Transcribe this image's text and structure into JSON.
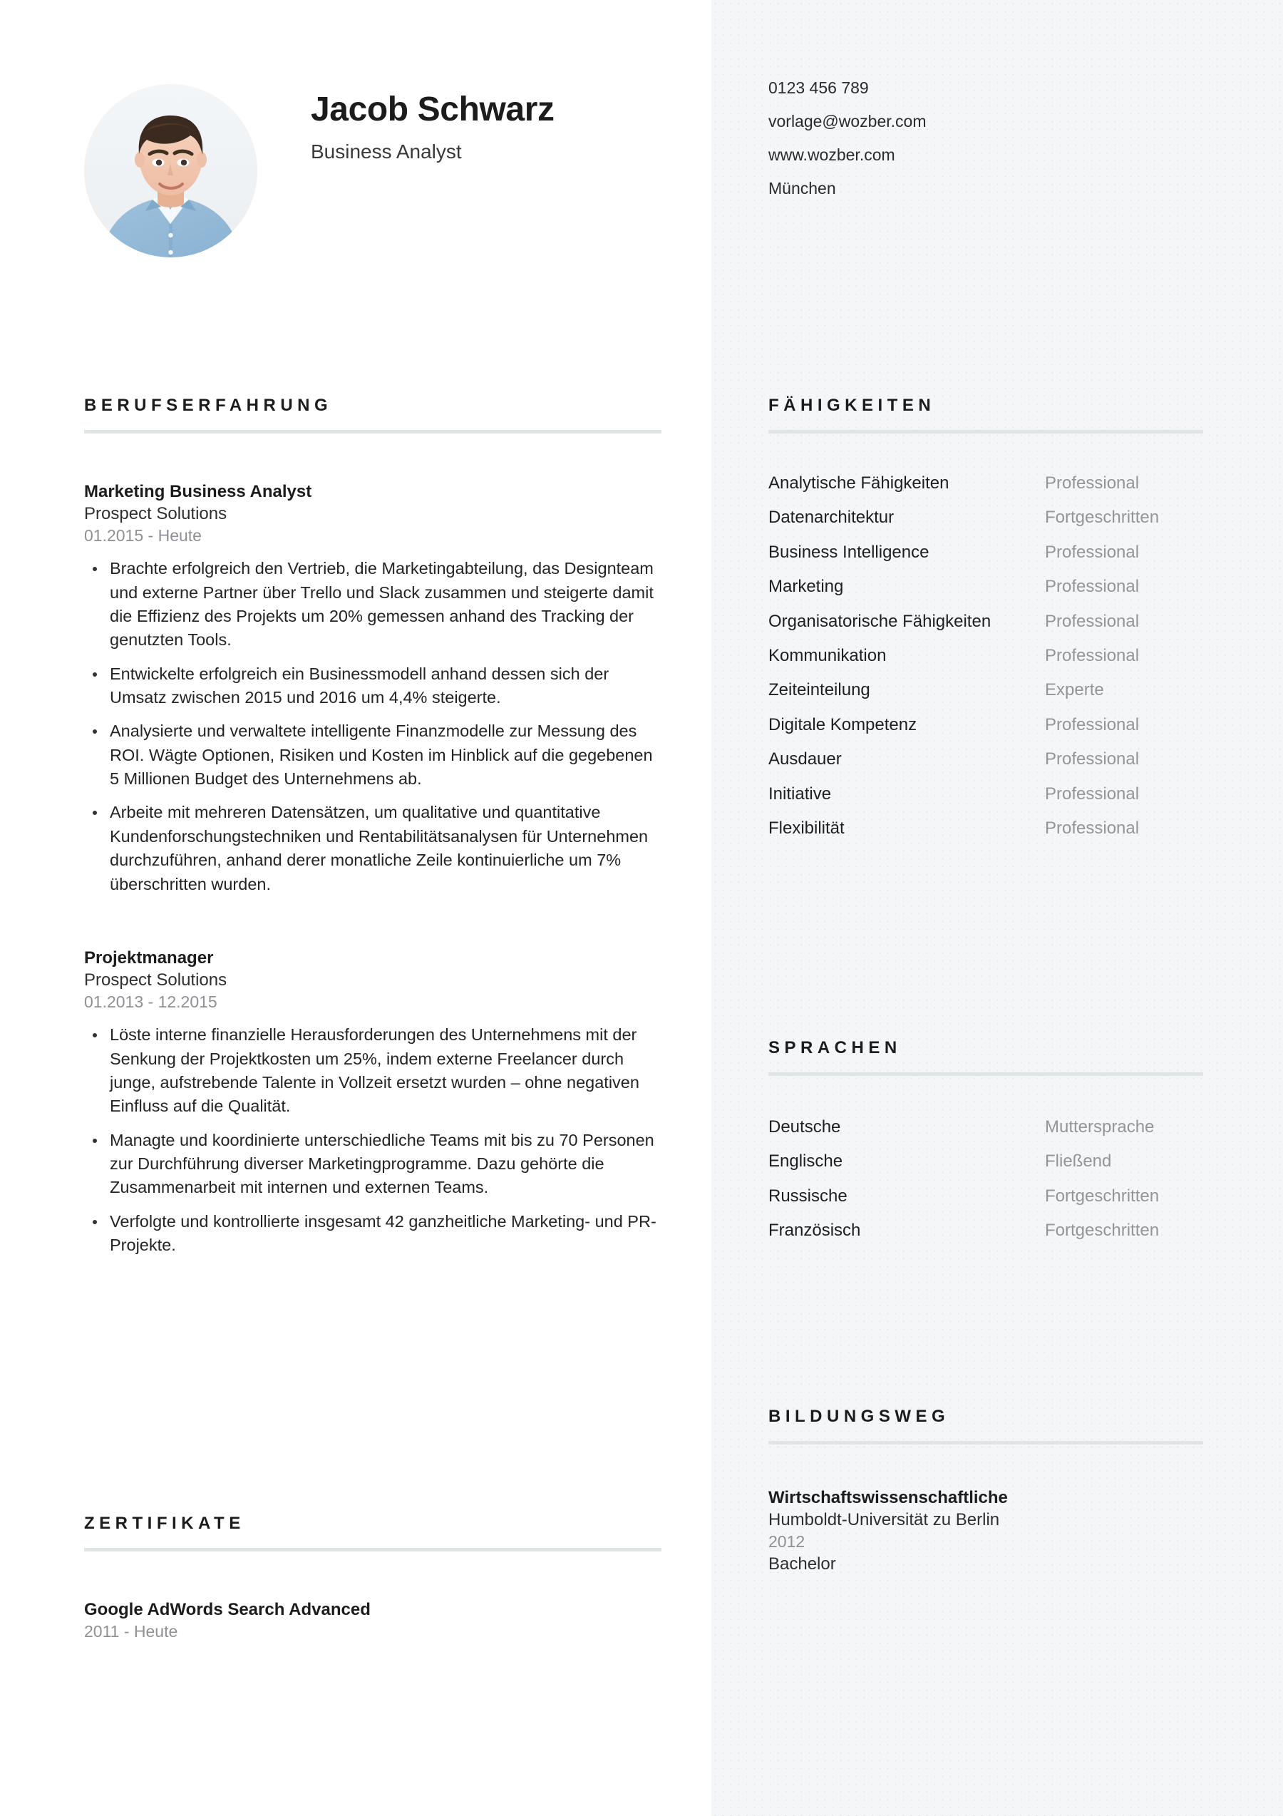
{
  "profile": {
    "name": "Jacob Schwarz",
    "job_title": "Business Analyst",
    "photo_alt": "portrait-photo"
  },
  "contact": {
    "phone": "0123 456 789",
    "email": "vorlage@wozber.com",
    "website": "www.wozber.com",
    "city": "München"
  },
  "sections": {
    "experience_title": "BERUFSERFAHRUNG",
    "certificates_title": "ZERTIFIKATE",
    "skills_title": "FÄHIGKEITEN",
    "languages_title": "SPRACHEN",
    "education_title": "BILDUNGSWEG"
  },
  "experience": [
    {
      "title": "Marketing Business Analyst",
      "company": "Prospect Solutions",
      "date": "01.2015 - Heute",
      "bullets": [
        "Brachte erfolgreich den Vertrieb, die Marketingabteilung, das Designteam und externe Partner über Trello und Slack zusammen und steigerte damit die Effizienz des Projekts um 20% gemessen anhand des Tracking der genutzten Tools.",
        "Entwickelte erfolgreich ein Businessmodell anhand dessen sich der Umsatz zwischen 2015 und 2016 um 4,4% steigerte.",
        "Analysierte und verwaltete intelligente Finanzmodelle zur Messung des ROI. Wägte Optionen, Risiken und Kosten im Hinblick auf die gegebenen 5 Millionen Budget des Unternehmens ab.",
        "Arbeite mit mehreren Datensätzen, um qualitative und quantitative Kundenforschungstechniken und Rentabilitätsanalysen für Unternehmen durchzuführen, anhand derer monatliche Zeile kontinuierliche um 7% überschritten wurden."
      ]
    },
    {
      "title": "Projektmanager",
      "company": "Prospect Solutions",
      "date": "01.2013 - 12.2015",
      "bullets": [
        "Löste interne finanzielle Herausforderungen des Unternehmens mit der Senkung der Projektkosten um 25%, indem externe Freelancer durch junge, aufstrebende Talente in Vollzeit ersetzt wurden – ohne negativen Einfluss auf die Qualität.",
        "Managte und koordinierte unterschiedliche Teams mit bis zu 70 Personen zur Durchführung diverser Marketingprogramme. Dazu gehörte die Zusammenarbeit mit internen und externen Teams.",
        "Verfolgte und kontrollierte insgesamt 42 ganzheitliche Marketing- und PR-Projekte."
      ]
    }
  ],
  "certificates": [
    {
      "title": "Google AdWords Search Advanced",
      "date": "2011 - Heute"
    }
  ],
  "skills": [
    {
      "name": "Analytische Fähigkeiten",
      "level": "Professional"
    },
    {
      "name": "Datenarchitektur",
      "level": "Fortgeschritten"
    },
    {
      "name": "Business Intelligence",
      "level": "Professional"
    },
    {
      "name": "Marketing",
      "level": "Professional"
    },
    {
      "name": "Organisatorische Fähigkeiten",
      "level": "Professional"
    },
    {
      "name": "Kommunikation",
      "level": "Professional"
    },
    {
      "name": "Zeiteinteilung",
      "level": "Experte"
    },
    {
      "name": "Digitale Kompetenz",
      "level": "Professional"
    },
    {
      "name": "Ausdauer",
      "level": "Professional"
    },
    {
      "name": "Initiative",
      "level": "Professional"
    },
    {
      "name": "Flexibilität",
      "level": "Professional"
    }
  ],
  "languages": [
    {
      "name": "Deutsche",
      "level": "Muttersprache"
    },
    {
      "name": "Englische",
      "level": "Fließend"
    },
    {
      "name": "Russische",
      "level": "Fortgeschritten"
    },
    {
      "name": "Französisch",
      "level": "Fortgeschritten"
    }
  ],
  "education": [
    {
      "degree": "Wirtschaftswissenschaftliche",
      "school": "Humboldt-Universität zu Berlin",
      "year": "2012",
      "level": "Bachelor"
    }
  ],
  "colors": {
    "page_background": "#ffffff",
    "sidebar_background": "#f4f6f8",
    "rule": "#dfe5e4",
    "text_primary": "#1c1c1c",
    "text_muted": "#8d9195"
  }
}
